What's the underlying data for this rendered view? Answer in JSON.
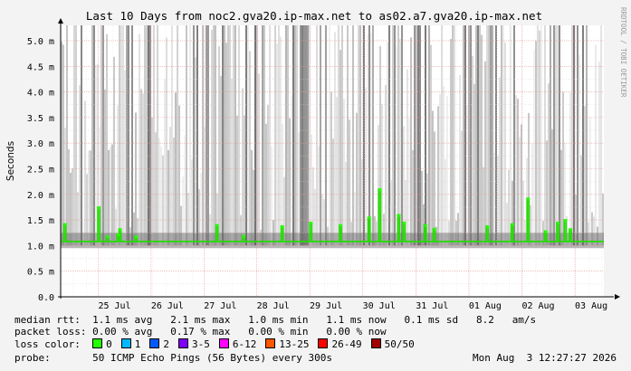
{
  "chart_data": {
    "type": "line",
    "title": "Last 10 Days from noc2.gva20.ip-max.net to as02.a7.gva20.ip-max.net",
    "ylabel": "Seconds",
    "watermark": "RRDTOOL / TOBI OETIKER",
    "y_ticks": [
      "0.0",
      "0.5 m",
      "1.0 m",
      "1.5 m",
      "2.0 m",
      "2.5 m",
      "3.0 m",
      "3.5 m",
      "4.0 m",
      "4.5 m",
      "5.0 m"
    ],
    "x_ticks": [
      "25 Jul",
      "26 Jul",
      "27 Jul",
      "28 Jul",
      "29 Jul",
      "30 Jul",
      "31 Jul",
      "01 Aug",
      "02 Aug",
      "03 Aug"
    ],
    "ylim": [
      0,
      5.3
    ],
    "y_unit": "ms",
    "grid": true,
    "median_rtt_baseline_ms": 1.08,
    "spikes_ms": [
      {
        "day": 0.08,
        "v": 1.42
      },
      {
        "day": 0.72,
        "v": 1.75
      },
      {
        "day": 0.88,
        "v": 1.18
      },
      {
        "day": 1.08,
        "v": 1.22
      },
      {
        "day": 1.12,
        "v": 1.32
      },
      {
        "day": 1.42,
        "v": 1.18
      },
      {
        "day": 2.95,
        "v": 1.4
      },
      {
        "day": 3.45,
        "v": 1.19
      },
      {
        "day": 4.18,
        "v": 1.38
      },
      {
        "day": 4.72,
        "v": 1.45
      },
      {
        "day": 5.28,
        "v": 1.4
      },
      {
        "day": 5.82,
        "v": 1.55
      },
      {
        "day": 6.02,
        "v": 2.1
      },
      {
        "day": 6.38,
        "v": 1.6
      },
      {
        "day": 6.48,
        "v": 1.45
      },
      {
        "day": 6.88,
        "v": 1.4
      },
      {
        "day": 7.05,
        "v": 1.33
      },
      {
        "day": 8.05,
        "v": 1.38
      },
      {
        "day": 8.52,
        "v": 1.42
      },
      {
        "day": 8.82,
        "v": 1.92
      },
      {
        "day": 9.15,
        "v": 1.28
      },
      {
        "day": 9.38,
        "v": 1.45
      },
      {
        "day": 9.52,
        "v": 1.5
      },
      {
        "day": 9.62,
        "v": 1.32
      }
    ]
  },
  "stats": {
    "median_rtt_label": "median rtt:",
    "median_rtt_values": "1.1 ms avg   2.1 ms max   1.0 ms min   1.1 ms now   0.1 ms sd   8.2   am/s",
    "packet_loss_label": "packet loss:",
    "packet_loss_values": "0.00 % avg   0.17 % max   0.00 % min   0.00 % now",
    "loss_color_label": "loss color:",
    "probe_label": "probe:",
    "probe_value": "50 ICMP Echo Pings (56 Bytes) every 300s",
    "timestamp": "Mon Aug  3 12:27:27 2026"
  },
  "loss_colors": [
    {
      "label": "0",
      "color": "#26ff00"
    },
    {
      "label": "1",
      "color": "#00b8ff"
    },
    {
      "label": "2",
      "color": "#0059ff"
    },
    {
      "label": "3-5",
      "color": "#7e00ff"
    },
    {
      "label": "6-12",
      "color": "#ff00ff"
    },
    {
      "label": "13-25",
      "color": "#ff5500"
    },
    {
      "label": "26-49",
      "color": "#ff0000"
    },
    {
      "label": "50/50",
      "color": "#a10000"
    }
  ]
}
